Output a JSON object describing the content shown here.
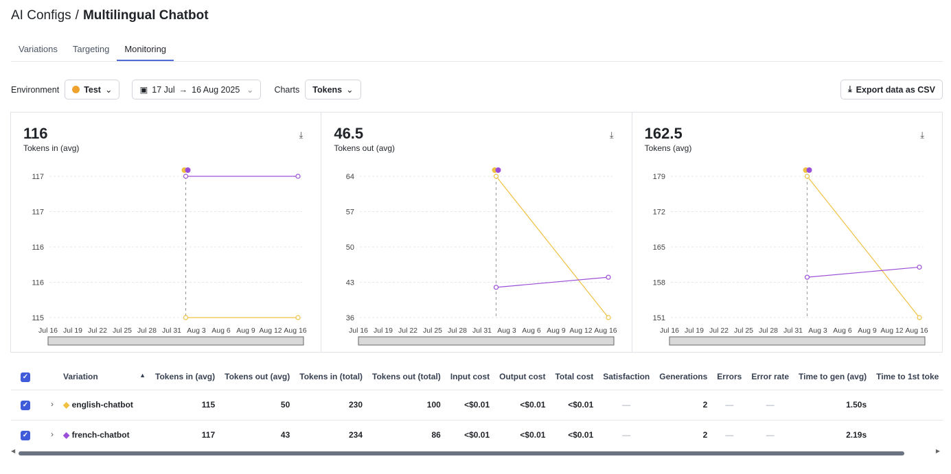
{
  "breadcrumb": {
    "parent": "AI Configs",
    "separator": "/",
    "current": "Multilingual Chatbot"
  },
  "tabs": [
    {
      "label": "Variations"
    },
    {
      "label": "Targeting"
    },
    {
      "label": "Monitoring",
      "active": true
    }
  ],
  "toolbar": {
    "environment_label": "Environment",
    "environment_value": "Test",
    "environment_color": "#f0a22e",
    "date_from": "17 Jul",
    "date_arrow": "→",
    "date_to": "16 Aug 2025",
    "charts_label": "Charts",
    "charts_value": "Tokens",
    "export_label": "Export data as CSV"
  },
  "colors": {
    "english": "#f0c040",
    "french": "#9b4fd8"
  },
  "chart_data": [
    {
      "type": "line",
      "summary": "116",
      "title": "Tokens in (avg)",
      "ylim": [
        115,
        117
      ],
      "yticks": [
        "117",
        "117",
        "116",
        "116",
        "115"
      ],
      "xticks": [
        "Jul 16",
        "Jul 19",
        "Jul 22",
        "Jul 25",
        "Jul 28",
        "Jul 31",
        "Aug 3",
        "Aug 6",
        "Aug 9",
        "Aug 12",
        "Aug 16"
      ],
      "x": [
        "2025-08-02",
        "2025-08-16"
      ],
      "series": [
        {
          "name": "english-chatbot",
          "values": [
            115,
            115
          ]
        },
        {
          "name": "french-chatbot",
          "values": [
            117,
            117
          ]
        }
      ]
    },
    {
      "type": "line",
      "summary": "46.5",
      "title": "Tokens out (avg)",
      "ylim": [
        36,
        64
      ],
      "yticks": [
        "64",
        "57",
        "50",
        "43",
        "36"
      ],
      "xticks": [
        "Jul 16",
        "Jul 19",
        "Jul 22",
        "Jul 25",
        "Jul 28",
        "Jul 31",
        "Aug 3",
        "Aug 6",
        "Aug 9",
        "Aug 12",
        "Aug 16"
      ],
      "x": [
        "2025-08-02",
        "2025-08-16"
      ],
      "series": [
        {
          "name": "english-chatbot",
          "values": [
            64,
            36
          ]
        },
        {
          "name": "french-chatbot",
          "values": [
            42,
            44
          ]
        }
      ]
    },
    {
      "type": "line",
      "summary": "162.5",
      "title": "Tokens (avg)",
      "ylim": [
        151,
        179
      ],
      "yticks": [
        "179",
        "172",
        "165",
        "158",
        "151"
      ],
      "xticks": [
        "Jul 16",
        "Jul 19",
        "Jul 22",
        "Jul 25",
        "Jul 28",
        "Jul 31",
        "Aug 3",
        "Aug 6",
        "Aug 9",
        "Aug 12",
        "Aug 16"
      ],
      "x": [
        "2025-08-02",
        "2025-08-16"
      ],
      "series": [
        {
          "name": "english-chatbot",
          "values": [
            179,
            151
          ]
        },
        {
          "name": "french-chatbot",
          "values": [
            159,
            161
          ]
        }
      ]
    }
  ],
  "table": {
    "columns": [
      "Variation",
      "Tokens in (avg)",
      "Tokens out (avg)",
      "Tokens in (total)",
      "Tokens out (total)",
      "Input cost",
      "Output cost",
      "Total cost",
      "Satisfaction",
      "Generations",
      "Errors",
      "Error rate",
      "Time to gen (avg)",
      "Time to 1st toke"
    ],
    "rows": [
      {
        "color": "#f0c040",
        "cells": [
          "english-chatbot",
          "115",
          "50",
          "230",
          "100",
          "<$0.01",
          "<$0.01",
          "<$0.01",
          "—",
          "2",
          "—",
          "—",
          "1.50s",
          ""
        ]
      },
      {
        "color": "#9b4fd8",
        "cells": [
          "french-chatbot",
          "117",
          "43",
          "234",
          "86",
          "<$0.01",
          "<$0.01",
          "<$0.01",
          "—",
          "2",
          "—",
          "—",
          "2.19s",
          ""
        ]
      }
    ]
  }
}
